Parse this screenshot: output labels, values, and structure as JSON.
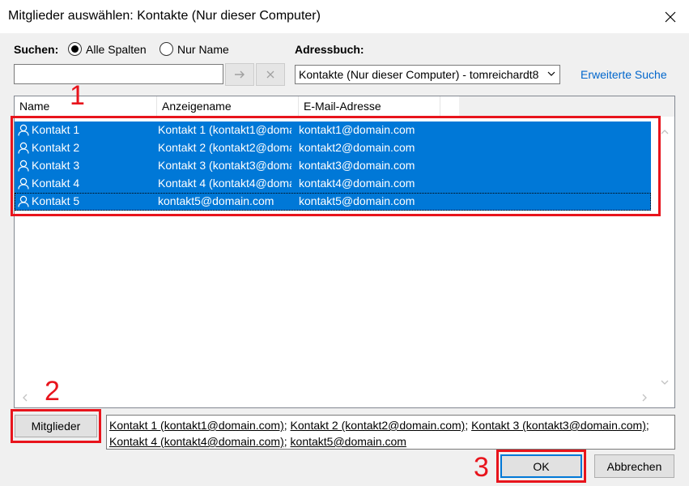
{
  "window": {
    "title": "Mitglieder auswählen: Kontakte (Nur dieser Computer)"
  },
  "search": {
    "label": "Suchen:",
    "option_all": "Alle Spalten",
    "option_name": "Nur Name",
    "value": "",
    "placeholder": ""
  },
  "addressbook": {
    "label": "Adressbuch:",
    "selected": "Kontakte (Nur dieser Computer) - tomreichardt8",
    "advanced_search": "Erweiterte Suche"
  },
  "table": {
    "columns": [
      "Name",
      "Anzeigename",
      "E-Mail-Adresse"
    ],
    "rows": [
      {
        "name": "Kontakt 1",
        "display": "Kontakt 1 (kontakt1@domain.com)",
        "email": "kontakt1@domain.com"
      },
      {
        "name": "Kontakt 2",
        "display": "Kontakt 2 (kontakt2@domain.com)",
        "email": "kontakt2@domain.com"
      },
      {
        "name": "Kontakt 3",
        "display": "Kontakt 3 (kontakt3@domain.com)",
        "email": "kontakt3@domain.com"
      },
      {
        "name": "Kontakt 4",
        "display": "Kontakt 4 (kontakt4@domain.com)",
        "email": "kontakt4@domain.com"
      },
      {
        "name": "Kontakt 5",
        "display": "kontakt5@domain.com",
        "email": "kontakt5@domain.com"
      }
    ]
  },
  "members": {
    "button_label": "Mitglieder",
    "entries": [
      "Kontakt 1 (kontakt1@domain.com)",
      "Kontakt 2 (kontakt2@domain.com)",
      "Kontakt 3 (kontakt3@domain.com)",
      "Kontakt 4 (kontakt4@domain.com)",
      "kontakt5@domain.com"
    ]
  },
  "buttons": {
    "ok": "OK",
    "cancel": "Abbrechen"
  },
  "annotations": [
    "1",
    "2",
    "3"
  ],
  "colors": {
    "selection": "#0078d7",
    "annotation": "#e8141c",
    "link": "#0066cc"
  },
  "icons": [
    "close-icon",
    "arrow-right-icon",
    "clear-x-icon",
    "chevron-down-icon",
    "contact-person-icon",
    "chevron-up-icon",
    "chevron-left-icon",
    "chevron-right-icon"
  ]
}
